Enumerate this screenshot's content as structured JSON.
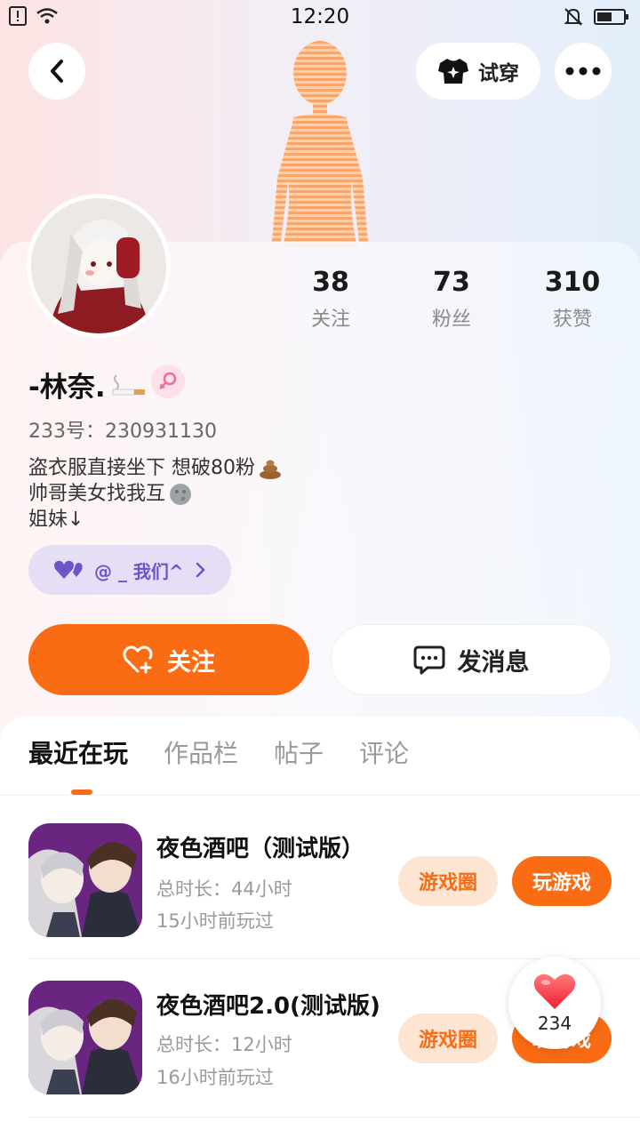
{
  "status_bar": {
    "time": "12:20"
  },
  "header": {
    "try_on_label": "试穿"
  },
  "profile": {
    "nickname": "-林奈.",
    "uid_text": "233号：230931130",
    "bio": [
      "盗衣服直接坐下 想破80粉",
      "帅哥美女找我互",
      "姐妹↓"
    ]
  },
  "stats": [
    {
      "num": "38",
      "label": "关注"
    },
    {
      "num": "73",
      "label": "粉丝"
    },
    {
      "num": "310",
      "label": "获赞"
    }
  ],
  "group": {
    "label": "@ _ 我们^"
  },
  "actions": {
    "follow_label": "关注",
    "message_label": "发消息"
  },
  "tabs": [
    "最近在玩",
    "作品栏",
    "帖子",
    "评论"
  ],
  "games": [
    {
      "name": "夜色酒吧（测试版）",
      "duration": "总时长：44小时",
      "last_played": "15小时前玩过",
      "circle_label": "游戏圈",
      "play_label": "玩游戏"
    },
    {
      "name": "夜色酒吧2.0(测试版)",
      "duration": "总时长：12小时",
      "last_played": "16小时前玩过",
      "circle_label": "游戏圈",
      "play_label": "玩游戏"
    }
  ],
  "like": {
    "count": "234"
  },
  "colors": {
    "accent": "#fa6c14",
    "group_text": "#6a55c9",
    "pill_bg": "#fde5d3"
  }
}
